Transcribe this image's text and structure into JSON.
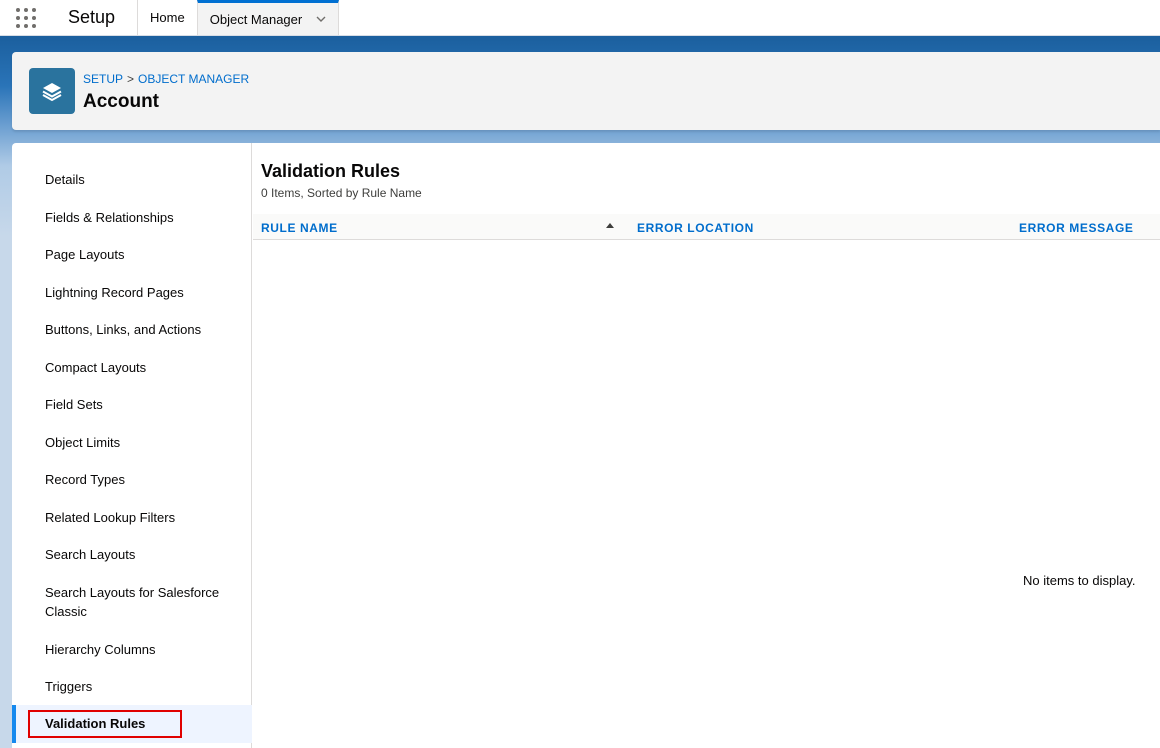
{
  "topnav": {
    "app_name": "Setup",
    "tabs": [
      {
        "label": "Home"
      },
      {
        "label": "Object Manager"
      }
    ]
  },
  "header": {
    "breadcrumb": [
      "SETUP",
      "OBJECT MANAGER"
    ],
    "breadcrumb_separator": ">",
    "title": "Account",
    "icon": "layers-icon",
    "icon_color": "#2a739e"
  },
  "sidebar": {
    "items": [
      {
        "label": "Details"
      },
      {
        "label": "Fields & Relationships"
      },
      {
        "label": "Page Layouts"
      },
      {
        "label": "Lightning Record Pages"
      },
      {
        "label": "Buttons, Links, and Actions"
      },
      {
        "label": "Compact Layouts"
      },
      {
        "label": "Field Sets"
      },
      {
        "label": "Object Limits"
      },
      {
        "label": "Record Types"
      },
      {
        "label": "Related Lookup Filters"
      },
      {
        "label": "Search Layouts"
      },
      {
        "label": "Search Layouts for Salesforce Classic"
      },
      {
        "label": "Hierarchy Columns"
      },
      {
        "label": "Triggers"
      },
      {
        "label": "Validation Rules"
      }
    ],
    "active_item": "Validation Rules"
  },
  "main": {
    "title": "Validation Rules",
    "subtitle": "0 Items, Sorted by Rule Name",
    "columns": [
      {
        "label": "RULE NAME",
        "sorted": "ascending"
      },
      {
        "label": "ERROR LOCATION"
      },
      {
        "label": "ERROR MESSAGE"
      }
    ],
    "rows": [],
    "empty_message": "No items to display."
  },
  "colors": {
    "accent": "#0070d2",
    "link": "#006dcc",
    "highlight": "#e00000"
  }
}
